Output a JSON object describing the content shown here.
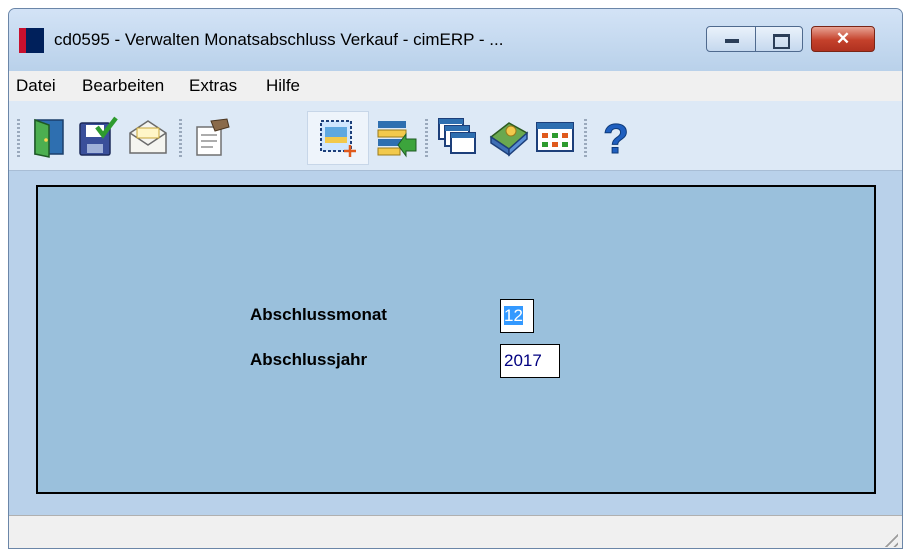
{
  "window": {
    "title": "cd0595  - Verwalten Monatsabschluss Verkauf - cimERP - ...",
    "close_symbol": "✕"
  },
  "menu": {
    "items": [
      "Datei",
      "Bearbeiten",
      "Extras",
      "Hilfe"
    ]
  },
  "toolbar": {
    "icons": [
      "exit-door-icon",
      "save-check-icon",
      "mail-envelope-icon",
      "properties-hand-icon",
      "new-selection-icon",
      "list-import-icon",
      "windows-cascade-icon",
      "book-help-icon",
      "calendar-grid-icon",
      "question-mark-icon"
    ],
    "help_symbol": "?"
  },
  "form": {
    "month_label": "Abschlussmonat",
    "month_value": "12",
    "year_label": "Abschlussjahr",
    "year_value": "2017"
  },
  "colors": {
    "panel": "#9ac0dc",
    "window_frame": "#b9d1ea",
    "selection": "#3399ff",
    "input_text": "#000080"
  }
}
